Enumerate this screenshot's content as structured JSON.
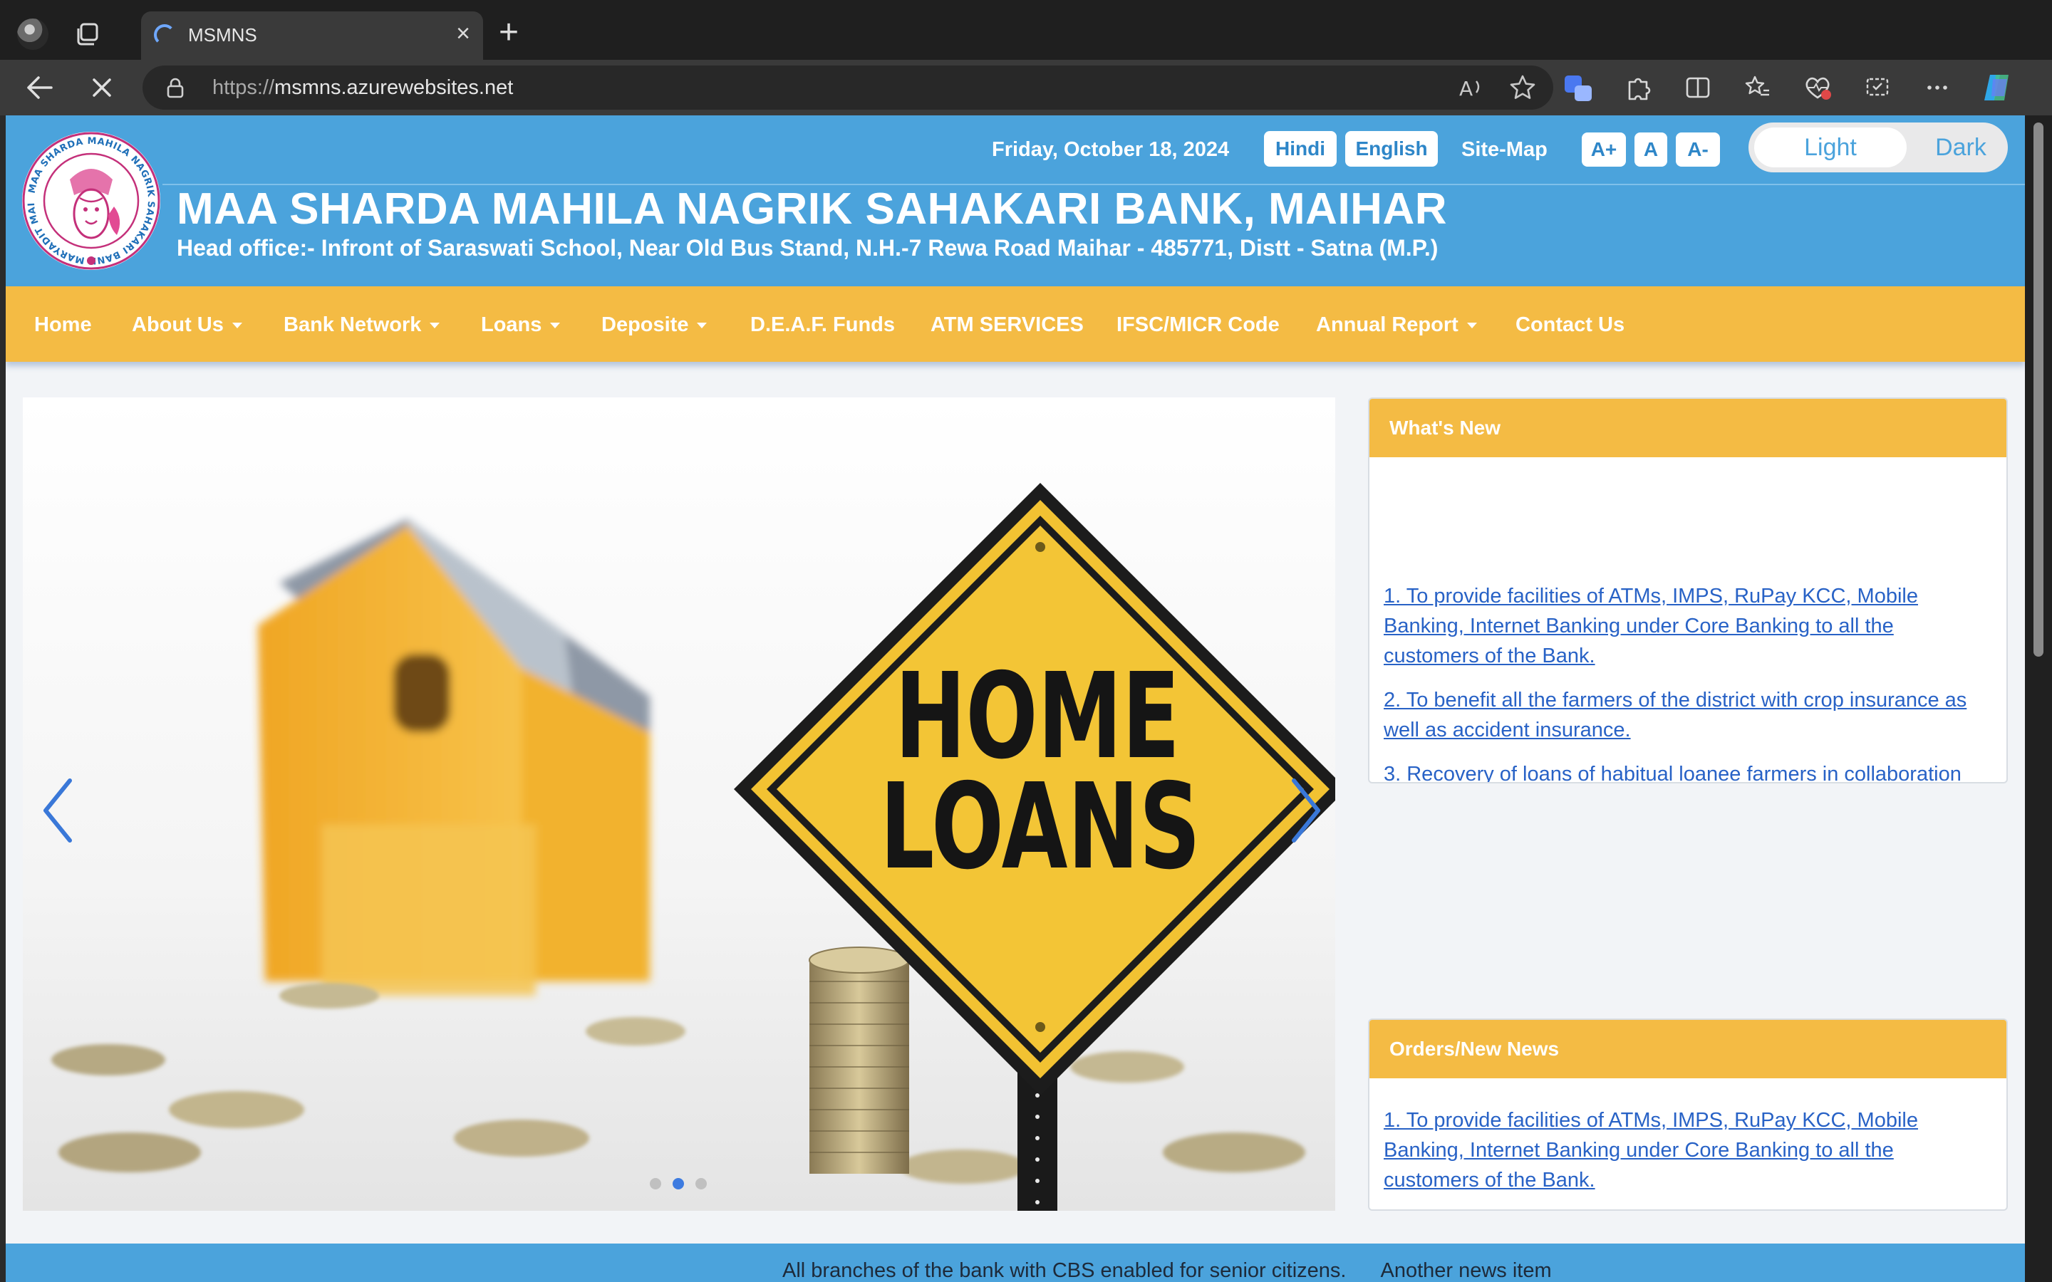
{
  "browser": {
    "tab_title": "MSMNS",
    "url_protocol": "https://",
    "url_host": "msmns.azurewebsites.net",
    "accent": "#6fa8ff"
  },
  "header": {
    "date": "Friday, October 18, 2024",
    "lang_hindi": "Hindi",
    "lang_english": "English",
    "sitemap": "Site-Map",
    "font_increase": "A+",
    "font_normal": "A",
    "font_decrease": "A-",
    "theme_light": "Light",
    "theme_dark": "Dark",
    "bank_name": "MAA SHARDA MAHILA NAGRIK SAHAKARI BANK, MAIHAR",
    "address": "Head office:- Infront of Saraswati School, Near Old Bus Stand, N.H.-7 Rewa Road Maihar - 485771, Distt - Satna (M.P.)",
    "logo_text": "MAA SHARDA MAHILA NAGRIK SAHAKARI BANK MARYADIT MAIHAR",
    "color": "#4ba3dc"
  },
  "nav": {
    "color": "#f4bb44",
    "items": [
      {
        "label": "Home"
      },
      {
        "label": "About Us"
      },
      {
        "label": "Bank Network"
      },
      {
        "label": "Loans"
      },
      {
        "label": "Deposite"
      },
      {
        "label": "D.E.A.F. Funds"
      },
      {
        "label": "ATM SERVICES"
      },
      {
        "label": "IFSC/MICR Code"
      },
      {
        "label": "Annual Report"
      },
      {
        "label": "Contact Us"
      }
    ]
  },
  "carousel": {
    "sign_line1": "HOME",
    "sign_line2": "LOANS",
    "slide_count": 3,
    "active_slide": 2
  },
  "whats_new": {
    "title": "What's New",
    "items": [
      "1. To provide facilities of ATMs, IMPS, RuPay KCC, Mobile Banking, Internet Banking under Core Banking to all the customers of the Bank.",
      "2. To benefit all the farmers of the district with crop insurance as well as accident insurance.",
      "3. Recovery of loans of habitual loanee farmers in collaboration"
    ]
  },
  "orders_news": {
    "title": "Orders/New News",
    "items": [
      "1. To provide facilities of ATMs, IMPS, RuPay KCC, Mobile Banking, Internet Banking under Core Banking to all the customers of the Bank."
    ]
  },
  "ticker": {
    "items": [
      "All branches of the bank with CBS enabled for senior citizens.",
      "Another news item"
    ]
  }
}
